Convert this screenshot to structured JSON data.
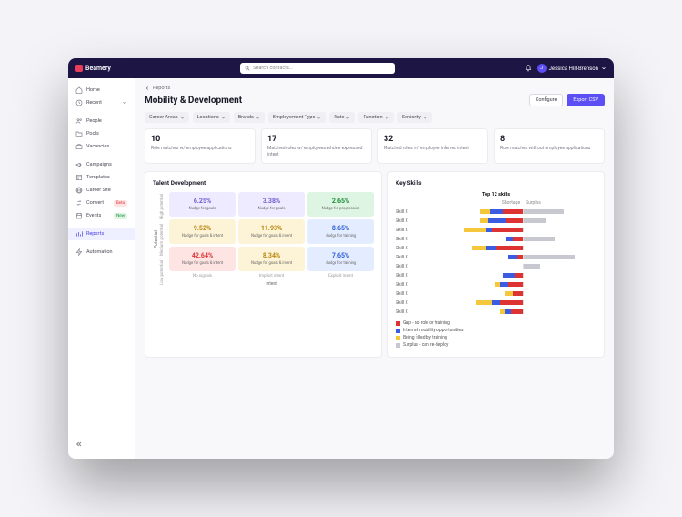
{
  "brand": "Beamery",
  "search": {
    "placeholder": "Search contacts..."
  },
  "user": {
    "name": "Jessica Hill-Brenson",
    "initial": "J"
  },
  "sidebar": {
    "items": [
      {
        "label": "Home",
        "icon": "home"
      },
      {
        "label": "Recent",
        "icon": "clock",
        "chevron": true
      },
      {
        "label": "People",
        "icon": "users"
      },
      {
        "label": "Pools",
        "icon": "folder"
      },
      {
        "label": "Vacancies",
        "icon": "briefcase"
      },
      {
        "label": "Campaigns",
        "icon": "megaphone"
      },
      {
        "label": "Templates",
        "icon": "template"
      },
      {
        "label": "Career Site",
        "icon": "globe"
      },
      {
        "label": "Convert",
        "icon": "convert",
        "badge": "Beta",
        "badgeKind": "beta"
      },
      {
        "label": "Events",
        "icon": "calendar",
        "badge": "New",
        "badgeKind": "new"
      },
      {
        "label": "Reports",
        "icon": "chart",
        "active": true
      },
      {
        "label": "Automation",
        "icon": "bolt"
      }
    ]
  },
  "breadcrumb": {
    "back": "Reports"
  },
  "pageTitle": "Mobility & Development",
  "actions": {
    "configure": "Configure",
    "export": "Export CSV"
  },
  "filters": [
    "Career Areas",
    "Locations",
    "Brands",
    "Employement Type",
    "Rate",
    "Function",
    "Seniority"
  ],
  "kpis": [
    {
      "value": "10",
      "label": "Role matches w/ employee applications"
    },
    {
      "value": "17",
      "label": "Matched roles w/ employees who've expressed intent"
    },
    {
      "value": "32",
      "label": "Matched roles w/ employee inferred intent"
    },
    {
      "value": "8",
      "label": "Role matches without employee applications"
    }
  ],
  "talent": {
    "title": "Talent Development",
    "yAxis": "Potential",
    "yLabels": [
      "High potential",
      "Medium potential",
      "Low potential"
    ],
    "xAxis": "Intent",
    "xLabels": [
      "No signals",
      "Implicit intent",
      "Explicit intent"
    ],
    "cells": [
      [
        {
          "pct": "6.25%",
          "sub": "Nudge for goals",
          "tone": "purple"
        },
        {
          "pct": "3.38%",
          "sub": "Nudge for goals",
          "tone": "purple"
        },
        {
          "pct": "2.65%",
          "sub": "Nudge for progression",
          "tone": "green"
        }
      ],
      [
        {
          "pct": "9.52%",
          "sub": "Nudge for goals & intent",
          "tone": "yellow"
        },
        {
          "pct": "11.93%",
          "sub": "Nudge for goals & intent",
          "tone": "yellow"
        },
        {
          "pct": "8.65%",
          "sub": "Nudge for training",
          "tone": "blue"
        }
      ],
      [
        {
          "pct": "42.64%",
          "sub": "Nudge for goals & intent",
          "tone": "red"
        },
        {
          "pct": "8.34%",
          "sub": "Nudge for goals & intent",
          "tone": "yellow"
        },
        {
          "pct": "7.65%",
          "sub": "Nudge for training",
          "tone": "blue"
        }
      ]
    ]
  },
  "skills": {
    "title": "Key Skills",
    "subtitle": "Top 12 skills",
    "colShortage": "Shortage",
    "colSurplus": "Surplus",
    "rows": [
      {
        "name": "Skill X",
        "short": {
          "red": 20,
          "blue": 12,
          "yellow": 10
        },
        "surp": 55
      },
      {
        "name": "Skill X",
        "short": {
          "red": 16,
          "blue": 18,
          "yellow": 8
        },
        "surp": 30
      },
      {
        "name": "Skill X",
        "short": {
          "red": 30,
          "blue": 6,
          "yellow": 22
        },
        "surp": 0
      },
      {
        "name": "Skill X",
        "short": {
          "red": 10,
          "blue": 6,
          "yellow": 0
        },
        "surp": 42
      },
      {
        "name": "Skill X",
        "short": {
          "red": 26,
          "blue": 10,
          "yellow": 14
        },
        "surp": 0
      },
      {
        "name": "Skill X",
        "short": {
          "red": 6,
          "blue": 8,
          "yellow": 0
        },
        "surp": 70
      },
      {
        "name": "Skill X",
        "short": {
          "red": 0,
          "blue": 0,
          "yellow": 0
        },
        "surp": 22
      },
      {
        "name": "Skill X",
        "short": {
          "red": 8,
          "blue": 12,
          "yellow": 0
        },
        "surp": 0
      },
      {
        "name": "Skill X",
        "short": {
          "red": 14,
          "blue": 8,
          "yellow": 6
        },
        "surp": 0
      },
      {
        "name": "Skill X",
        "short": {
          "red": 10,
          "blue": 0,
          "yellow": 8
        },
        "surp": 0
      },
      {
        "name": "Skill X",
        "short": {
          "red": 22,
          "blue": 8,
          "yellow": 16
        },
        "surp": 0
      },
      {
        "name": "Skill X",
        "short": {
          "red": 12,
          "blue": 6,
          "yellow": 4
        },
        "surp": 0
      }
    ],
    "legend": [
      {
        "color": "#d33",
        "label": "Gap - no role or training"
      },
      {
        "color": "#3b5be0",
        "label": "Internal mobility opportunities"
      },
      {
        "color": "#f5c83b",
        "label": "Being filled by training"
      },
      {
        "color": "#c8c8d0",
        "label": "Surplus - can re-deploy"
      }
    ]
  },
  "chart_data": {
    "type": "bar",
    "title": "Top 12 skills",
    "categories": [
      "Skill X",
      "Skill X",
      "Skill X",
      "Skill X",
      "Skill X",
      "Skill X",
      "Skill X",
      "Skill X",
      "Skill X",
      "Skill X",
      "Skill X",
      "Skill X"
    ],
    "series": [
      {
        "name": "Gap - no role or training",
        "values": [
          -20,
          -16,
          -30,
          -10,
          -26,
          -6,
          0,
          -8,
          -14,
          -10,
          -22,
          -12
        ]
      },
      {
        "name": "Internal mobility opportunities",
        "values": [
          -12,
          -18,
          -6,
          -6,
          -10,
          -8,
          0,
          -12,
          -8,
          0,
          -8,
          -6
        ]
      },
      {
        "name": "Being filled by training",
        "values": [
          -10,
          -8,
          -22,
          0,
          -14,
          0,
          0,
          0,
          -6,
          -8,
          -16,
          -4
        ]
      },
      {
        "name": "Surplus - can re-deploy",
        "values": [
          55,
          30,
          0,
          42,
          0,
          70,
          22,
          0,
          0,
          0,
          0,
          0
        ]
      }
    ],
    "xlabel": "Shortage / Surplus",
    "ylabel": "Skill"
  }
}
